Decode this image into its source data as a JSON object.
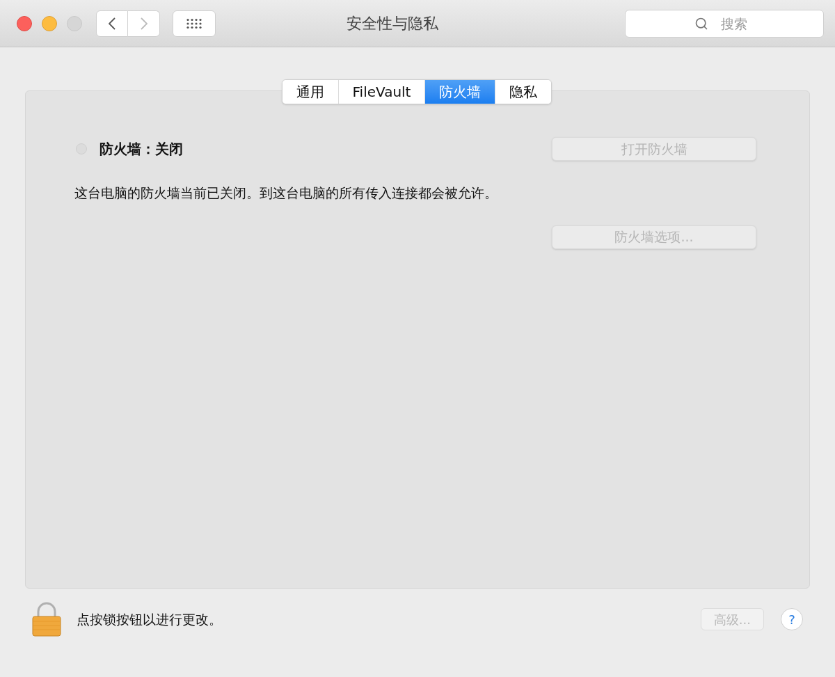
{
  "window": {
    "title": "安全性与隐私"
  },
  "search": {
    "placeholder": "搜索"
  },
  "tabs": [
    {
      "label": "通用",
      "selected": false
    },
    {
      "label": "FileVault",
      "selected": false
    },
    {
      "label": "防火墙",
      "selected": true
    },
    {
      "label": "隐私",
      "selected": false
    }
  ],
  "firewall": {
    "status_label": "防火墙：关闭",
    "on": false,
    "description": "这台电脑的防火墙当前已关闭。到这台电脑的所有传入连接都会被允许。",
    "buttons": [
      {
        "label": "打开防火墙",
        "disabled": true
      },
      {
        "label": "防火墙选项...",
        "disabled": true
      }
    ]
  },
  "footer": {
    "lock_text": "点按锁按钮以进行更改。",
    "advanced_button": {
      "label": "高级...",
      "disabled": true
    },
    "help_button": {
      "label": "?"
    }
  }
}
